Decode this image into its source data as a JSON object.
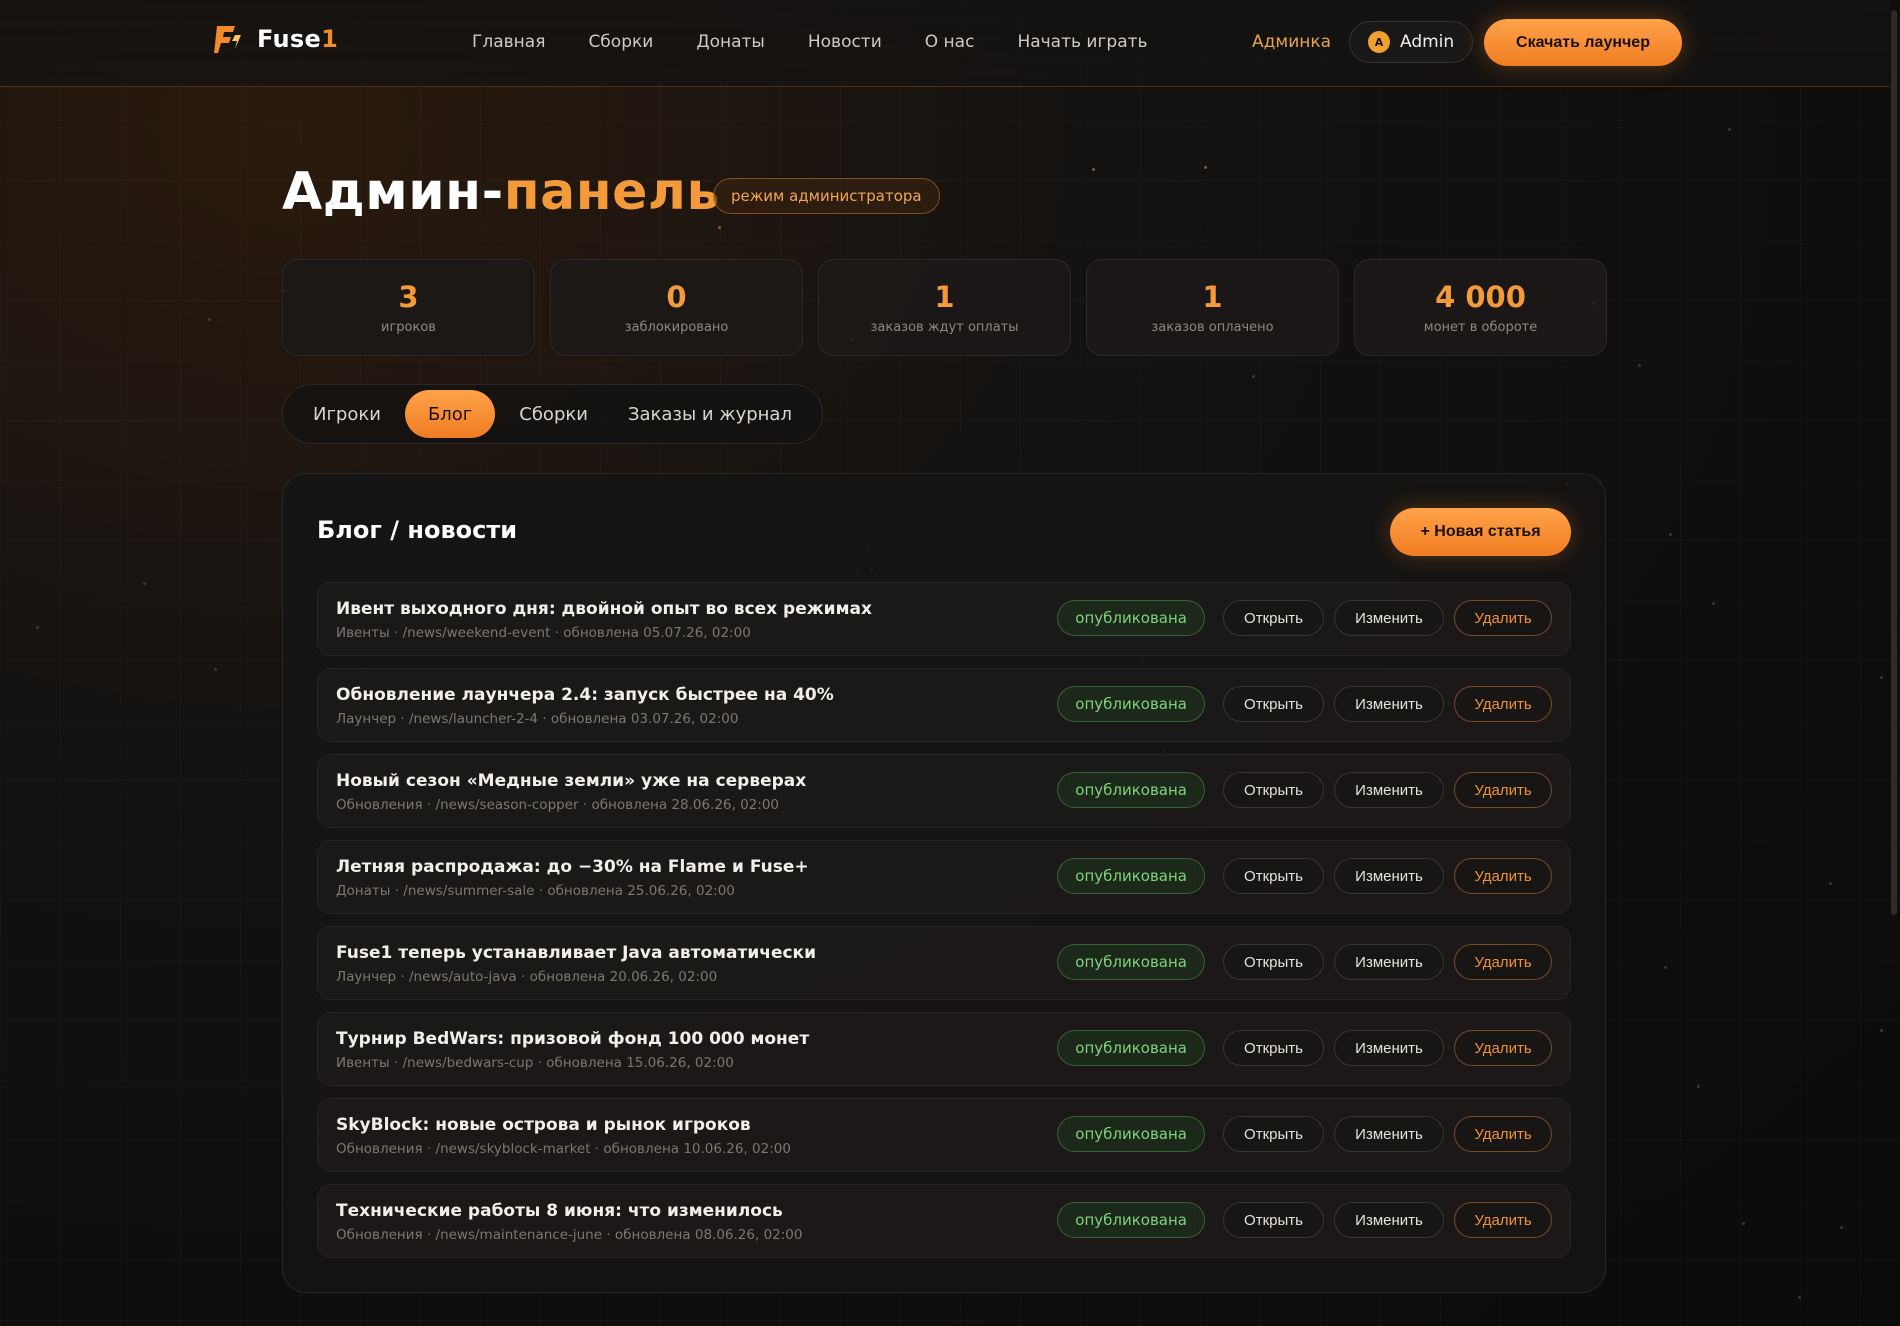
{
  "brand": {
    "name_main": "Fuse",
    "name_accent": "1"
  },
  "nav": {
    "items": [
      "Главная",
      "Сборки",
      "Донаты",
      "Новости",
      "О нас",
      "Начать играть"
    ],
    "admin_link": "Админка",
    "user": {
      "initial": "A",
      "name": "Admin"
    },
    "download_label": "Скачать лаунчер"
  },
  "page": {
    "title_main": "Админ-",
    "title_accent": "панель",
    "mode_badge": "режим администратора"
  },
  "stats": [
    {
      "value": "3",
      "label": "игроков"
    },
    {
      "value": "0",
      "label": "заблокировано"
    },
    {
      "value": "1",
      "label": "заказов ждут оплаты"
    },
    {
      "value": "1",
      "label": "заказов оплачено"
    },
    {
      "value": "4 000",
      "label": "монет в обороте"
    }
  ],
  "tabs": [
    {
      "label": "Игроки",
      "active": false
    },
    {
      "label": "Блог",
      "active": true
    },
    {
      "label": "Сборки",
      "active": false
    },
    {
      "label": "Заказы и журнал",
      "active": false
    }
  ],
  "panel": {
    "title": "Блог / новости",
    "new_button": "+ Новая статья",
    "actions": {
      "open": "Открыть",
      "edit": "Изменить",
      "delete": "Удалить"
    },
    "articles": [
      {
        "title": "Ивент выходного дня: двойной опыт во всех режимах",
        "meta": "Ивенты · /news/weekend-event · обновлена 05.07.26, 02:00",
        "status": "опубликована"
      },
      {
        "title": "Обновление лаунчера 2.4: запуск быстрее на 40%",
        "meta": "Лаунчер · /news/launcher-2-4 · обновлена 03.07.26, 02:00",
        "status": "опубликована"
      },
      {
        "title": "Новый сезон «Медные земли» уже на серверах",
        "meta": "Обновления · /news/season-copper · обновлена 28.06.26, 02:00",
        "status": "опубликована"
      },
      {
        "title": "Летняя распродажа: до −30% на Flame и Fuse+",
        "meta": "Донаты · /news/summer-sale · обновлена 25.06.26, 02:00",
        "status": "опубликована"
      },
      {
        "title": "Fuse1 теперь устанавливает Java автоматически",
        "meta": "Лаунчер · /news/auto-java · обновлена 20.06.26, 02:00",
        "status": "опубликована"
      },
      {
        "title": "Турнир BedWars: призовой фонд 100 000 монет",
        "meta": "Ивенты · /news/bedwars-cup · обновлена 15.06.26, 02:00",
        "status": "опубликована"
      },
      {
        "title": "SkyBlock: новые острова и рынок игроков",
        "meta": "Обновления · /news/skyblock-market · обновлена 10.06.26, 02:00",
        "status": "опубликована"
      },
      {
        "title": "Технические работы 8 июня: что изменилось",
        "meta": "Обновления · /news/maintenance-june · обновлена 08.06.26, 02:00",
        "status": "опубликована"
      }
    ]
  },
  "colors": {
    "accent": "#f39a3a",
    "published": "#7ed37a",
    "background": "#121110"
  }
}
